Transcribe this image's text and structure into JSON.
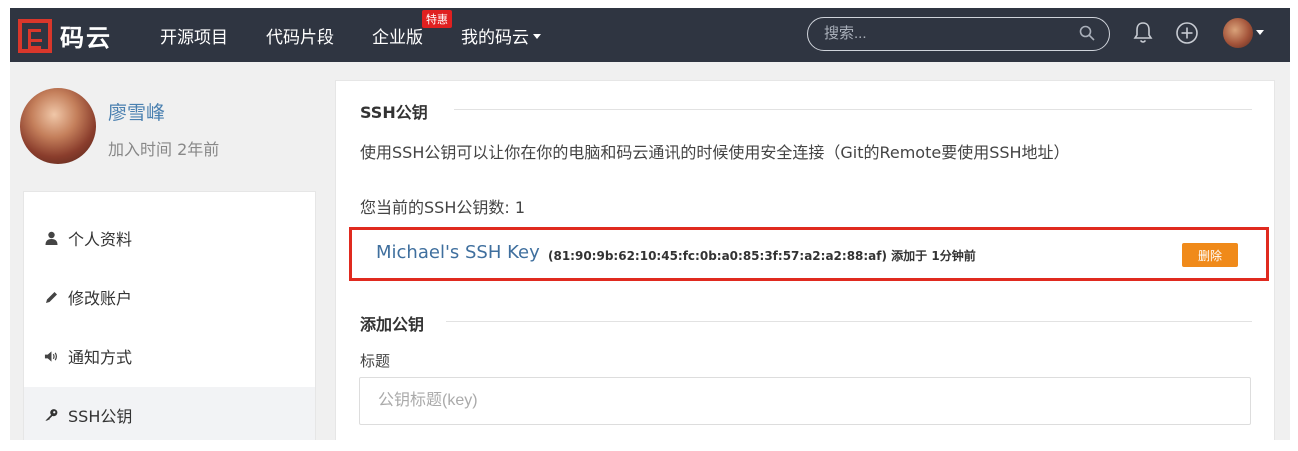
{
  "brand": {
    "name": "码云"
  },
  "nav": {
    "items": [
      {
        "label": "开源项目"
      },
      {
        "label": "代码片段"
      },
      {
        "label": "企业版",
        "badge": "特惠"
      },
      {
        "label": "我的码云",
        "has_dropdown": true
      }
    ],
    "search_placeholder": "搜索...",
    "icons": [
      "search-icon",
      "bell-icon",
      "plus-icon",
      "avatar"
    ]
  },
  "profile": {
    "name": "廖雪峰",
    "joined": "加入时间 2年前"
  },
  "sidebar": {
    "items": [
      {
        "label": "个人资料",
        "icon": "user-icon",
        "active": false
      },
      {
        "label": "修改账户",
        "icon": "pencil-icon",
        "active": false
      },
      {
        "label": "通知方式",
        "icon": "volume-icon",
        "active": false
      },
      {
        "label": "SSH公钥",
        "icon": "key-icon",
        "active": true
      }
    ]
  },
  "main": {
    "ssh_title": "SSH公钥",
    "description": "使用SSH公钥可以让你在你的电脑和码云通讯的时候使用安全连接（Git的Remote要使用SSH地址）",
    "count_text": "您当前的SSH公钥数: 1",
    "keys": [
      {
        "name": "Michael's SSH Key",
        "meta": "(81:90:9b:62:10:45:fc:0b:a0:85:3f:57:a2:a2:88:af) 添加于 1分钟前",
        "delete_label": "删除"
      }
    ],
    "add_title": "添加公钥",
    "field_label": "标题",
    "title_placeholder": "公钥标题(key)"
  },
  "colors": {
    "topbar_bg": "#2f3541",
    "brand_red": "#d9372b",
    "highlight_border": "#e02a1f",
    "delete_button": "#f08a1a",
    "link_blue": "#3f6f9e"
  }
}
